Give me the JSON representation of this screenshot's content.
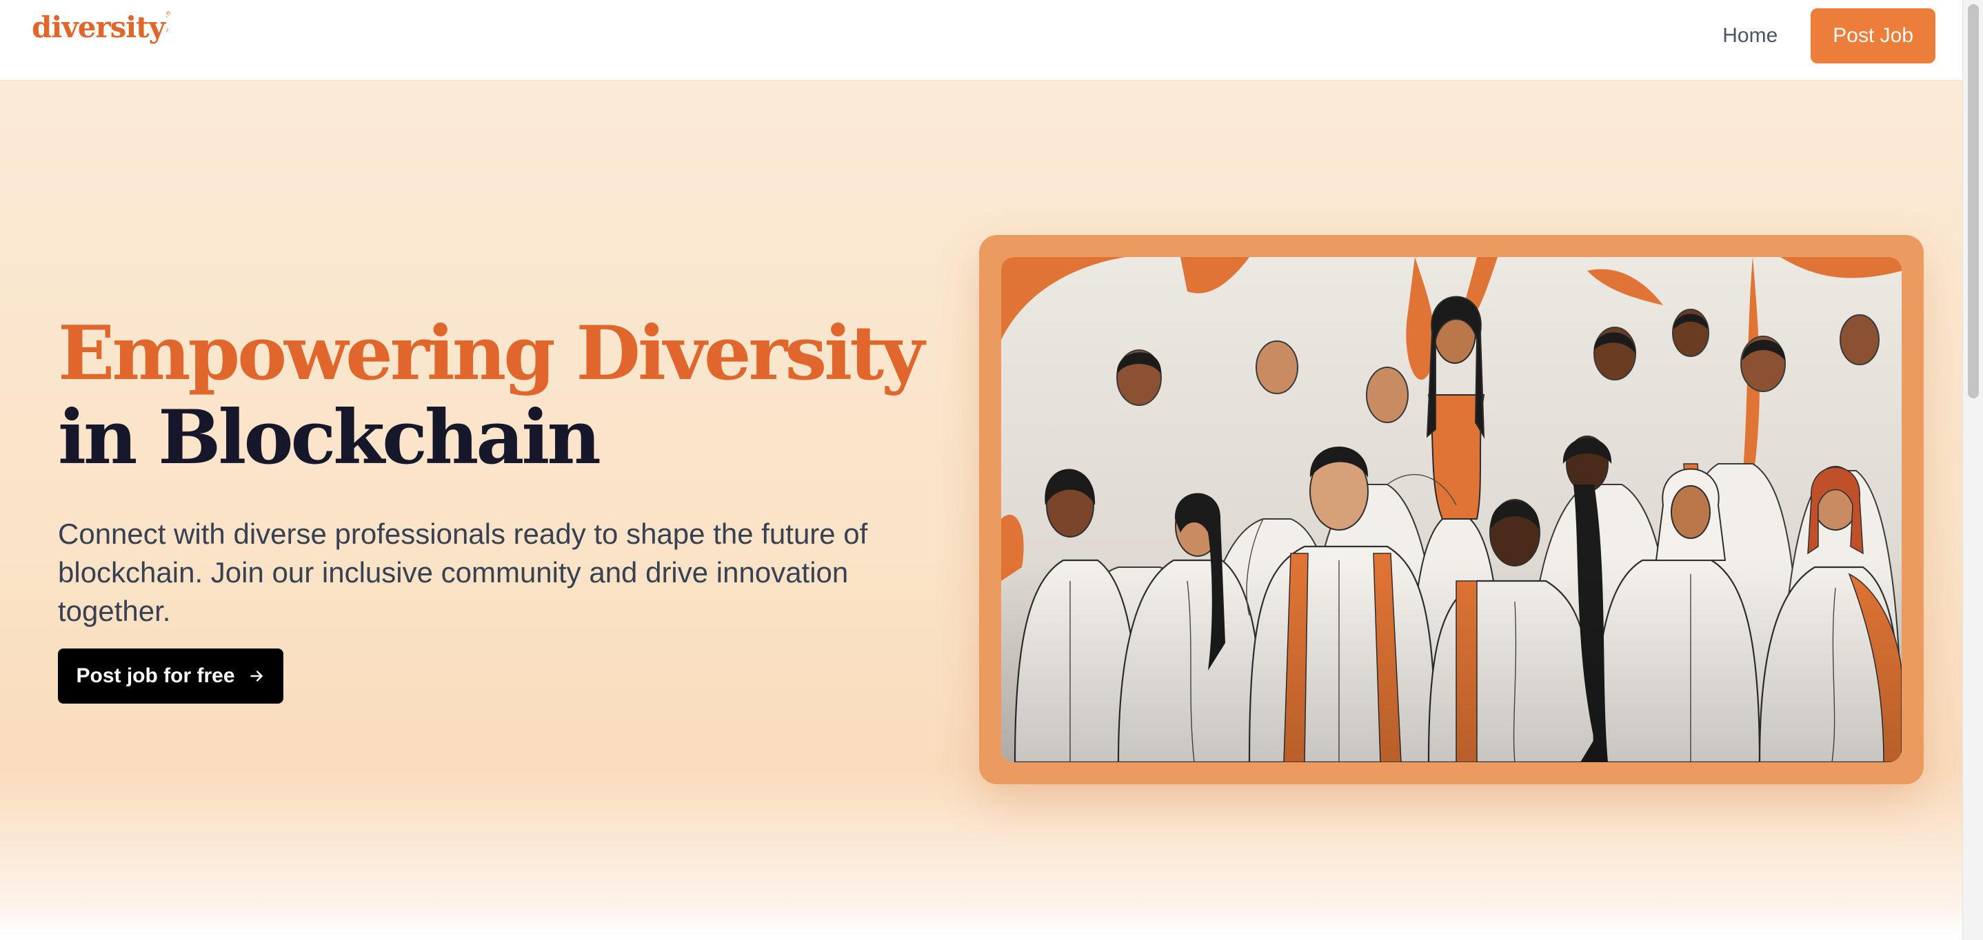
{
  "brand": {
    "logo_text": "diversity",
    "logo_badge_text": "chain",
    "accent_color": "#e0662c"
  },
  "nav": {
    "home_label": "Home",
    "post_job_label": "Post Job",
    "post_job_color": "#ed7d3a"
  },
  "hero": {
    "title_line1": "Empowering Diversity",
    "title_line2": "in Blockchain",
    "subtitle": "Connect with diverse professionals ready to shape the future of blockchain. Join our inclusive community and drive innovation together.",
    "cta_label": "Post job for free",
    "cta_icon": "arrow-right-icon"
  },
  "illustration": {
    "subject": "group-of-diverse-people-illustration",
    "palette": [
      "#e8e3dc",
      "#e07434",
      "#1b1b1b",
      "#8a5232"
    ]
  }
}
